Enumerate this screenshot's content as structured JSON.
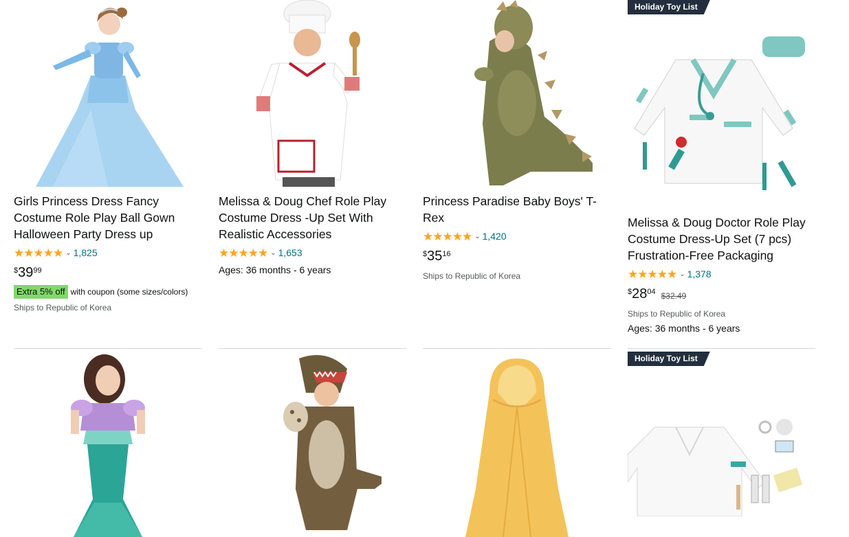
{
  "products": [
    {
      "title": "Girls Princess Dress Fancy Costume Role Play Ball Gown Halloween Party Dress up",
      "stars": "★★★★★",
      "rating_count": "1,825",
      "price_symbol": "$",
      "price_whole": "39",
      "price_fraction": "99",
      "coupon_tag": "Extra 5% off",
      "coupon_text": "with coupon (some sizes/colors)",
      "ships": "Ships to Republic of Korea"
    },
    {
      "title": "Melissa & Doug Chef Role Play Costume Dress -Up Set With Realistic Accessories",
      "stars": "★★★★★",
      "rating_count": "1,653",
      "ages": "Ages: 36 months - 6 years"
    },
    {
      "title": "Princess Paradise Baby Boys' T-Rex",
      "stars": "★★★★★",
      "rating_count": "1,420",
      "price_symbol": "$",
      "price_whole": "35",
      "price_fraction": "16",
      "ships": "Ships to Republic of Korea"
    },
    {
      "badge": "Holiday Toy List",
      "title": "Melissa & Doug Doctor Role Play Costume Dress-Up Set (7 pcs) Frustration-Free Packaging",
      "stars": "★★★★★",
      "rating_count": "1,378",
      "price_symbol": "$",
      "price_whole": "28",
      "price_fraction": "04",
      "list_price": "$32.49",
      "ships": "Ships to Republic of Korea",
      "ages": "Ages: 36 months - 6 years"
    },
    {
      "image": "mermaid-costume"
    },
    {
      "image": "t-rex-costume"
    },
    {
      "image": "yellow-cape"
    },
    {
      "badge": "Holiday Toy List",
      "image": "lab-coat-set"
    }
  ],
  "colors": {
    "star": "#ffa41c",
    "link": "#007185",
    "badge_bg": "#232f3e",
    "coupon_bg": "#7fda69"
  }
}
